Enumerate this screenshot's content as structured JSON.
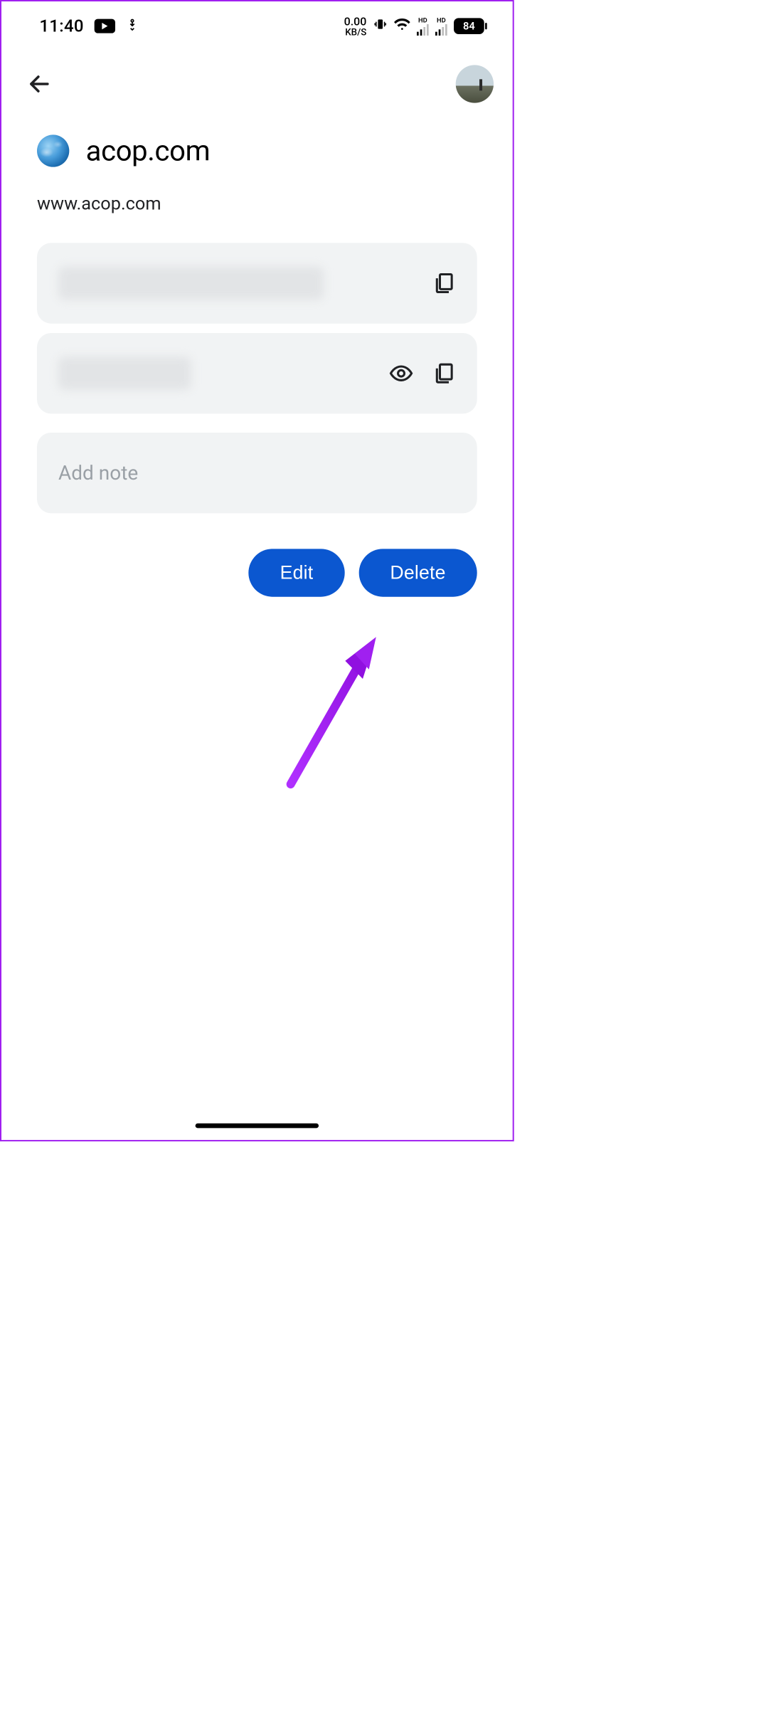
{
  "status": {
    "time": "11:40",
    "dataRate": "0.00",
    "dataRateUnit": "KB/S",
    "hd1": "HD",
    "hd2": "HD",
    "battery": "84"
  },
  "site": {
    "title": "acop.com",
    "url": "www.acop.com"
  },
  "note": {
    "placeholder": "Add note"
  },
  "buttons": {
    "edit": "Edit",
    "delete": "Delete"
  }
}
